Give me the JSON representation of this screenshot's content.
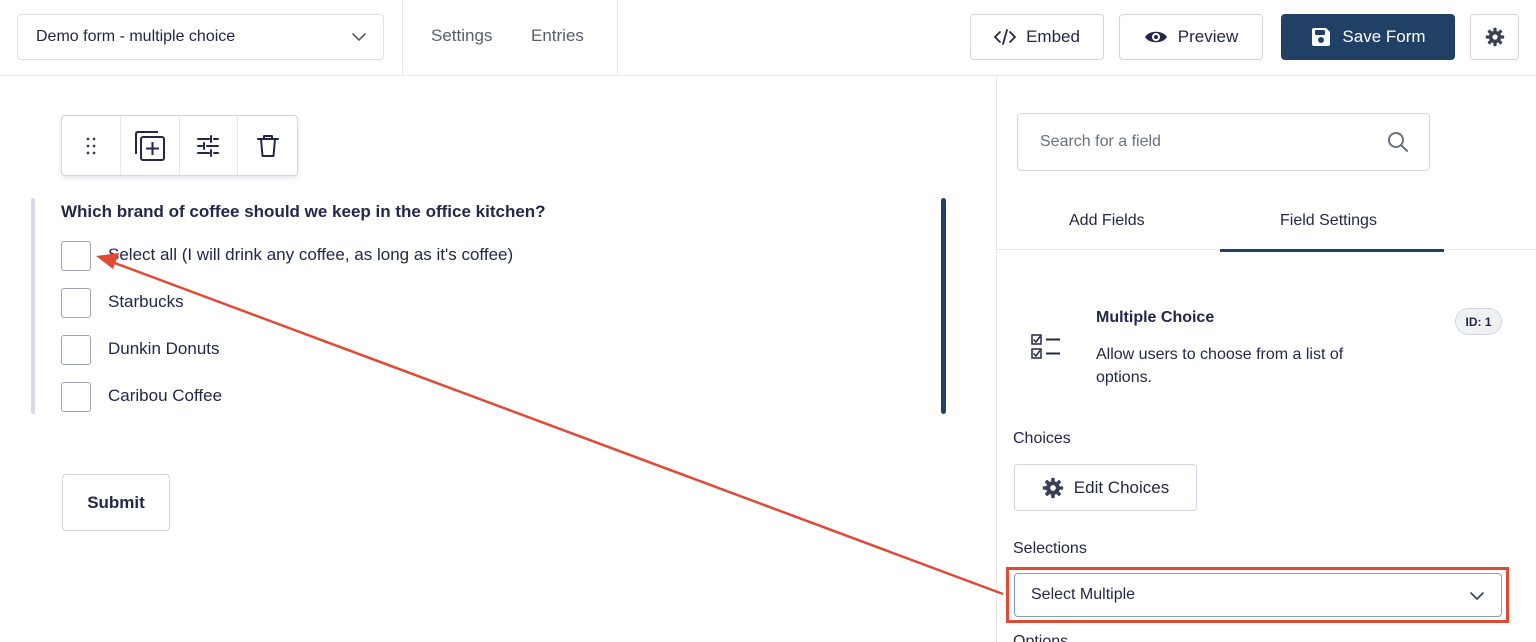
{
  "header": {
    "form_selector_value": "Demo form - multiple choice",
    "nav": [
      "Settings",
      "Entries"
    ],
    "embed_label": "Embed",
    "preview_label": "Preview",
    "save_label": "Save Form"
  },
  "field": {
    "question": "Which brand of coffee should we keep in the office kitchen?",
    "choices": [
      "Select all (I will drink any coffee, as long as it's coffee)",
      "Starbucks",
      "Dunkin Donuts",
      "Caribou Coffee"
    ]
  },
  "form": {
    "submit_label": "Submit"
  },
  "sidebar": {
    "search_placeholder": "Search for a field",
    "tabs": [
      "Add Fields",
      "Field Settings"
    ],
    "active_tab": "Field Settings",
    "field_type": {
      "title": "Multiple Choice",
      "description": "Allow users to choose from a list of options.",
      "id_badge": "ID: 1"
    },
    "choices_label": "Choices",
    "edit_choices_label": "Edit Choices",
    "selections_label": "Selections",
    "selections_value": "Select Multiple",
    "next_section_label": "Options"
  },
  "colors": {
    "primary": "#204066",
    "annotation": "#e04a35",
    "text": "#242748"
  }
}
